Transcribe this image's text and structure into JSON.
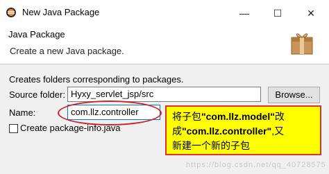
{
  "window": {
    "title": "New Java Package",
    "controls": {
      "minimize": "—",
      "maximize": "☐",
      "close": "✕"
    }
  },
  "banner": {
    "title": "Java Package",
    "description": "Create a new Java package."
  },
  "form": {
    "intro": "Creates folders corresponding to packages.",
    "source_folder_label": "Source folder:",
    "source_folder_value": "Hyxy_servlet_jsp/src",
    "browse_label": "Browse...",
    "name_label": "Name:",
    "name_value": "com.llz.controller",
    "create_info_label": "Create package-info.java"
  },
  "annotation": {
    "line1_pre": "将子包",
    "line1_bold": "\"com.llz.model\"",
    "line1_post": "改",
    "line2_pre": "成",
    "line2_bold": "\"com.llz.controller\"",
    "line2_post": ",又",
    "line3": "新建一个新的子包",
    "color_fill": "#ffff00",
    "color_border": "#e03030"
  },
  "watermark": "https://blog.csdn.net/qq_40728575"
}
